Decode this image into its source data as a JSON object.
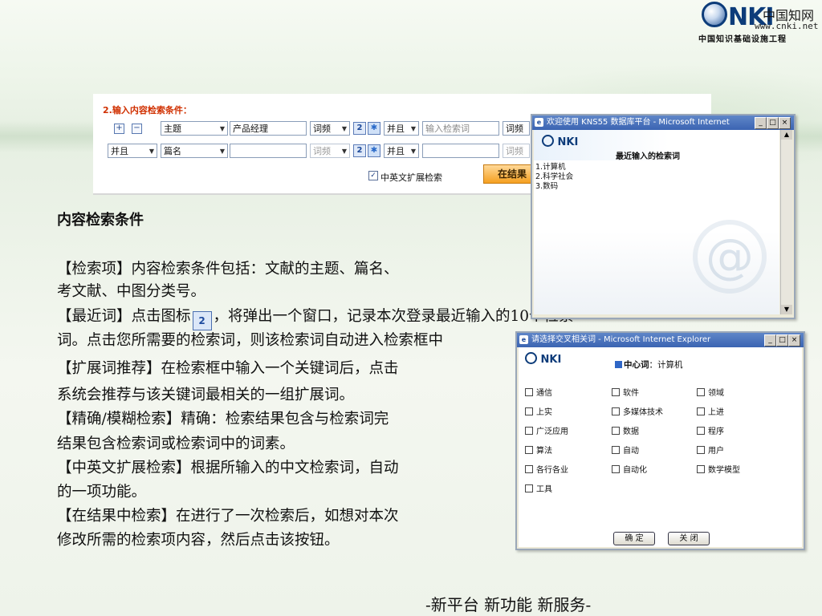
{
  "logo": {
    "cn": "中国知网",
    "url": "www.cnki.net",
    "sub": "中国知识基础设施工程",
    "mark": "NKI"
  },
  "search_panel": {
    "title": "2.输入内容检索条件：",
    "row1": {
      "field": "主题",
      "value": "产品经理",
      "freq": "词频",
      "logic": "并且",
      "placeholder": "输入检索词",
      "freq2": "词频"
    },
    "row2": {
      "logic_left": "并且",
      "field": "篇名",
      "value": "",
      "freq": "词频",
      "logic": "并且",
      "value2": "",
      "freq2": "词频"
    },
    "ext_label": "中英文扩展检索",
    "ext_checked": true,
    "search_in_results": "在结果"
  },
  "body": {
    "heading": "内容检索条件",
    "lines": [
      "【检索项】内容检索条件包括：文献的主题、篇名、",
      "考文献、中图分类号。",
      "【最近词】点击图标",
      "，将弹出一个窗口，记录本次登录最近输入的10个检索",
      "词。点击您所需要的检索词，则该检索词自动进入检索框中",
      "【扩展词推荐】在检索框中输入一个关键词后，点击",
      "系统会推荐与该关键词最相关的一组扩展词。",
      "【精确/模糊检索】精确：检索结果包含与检索词完",
      "结果包含检索词或检索词中的词素。",
      "【中英文扩展检索】根据所输入的中文检索词，自动",
      "的一项功能。",
      "【在结果中检索】在进行了一次检索后，如想对本次",
      "修改所需的检索项内容，然后点击该按钮。"
    ]
  },
  "footer": "-新平台 新功能 新服务-",
  "recent_window": {
    "title": "欢迎使用 KNS55 数据库平台 - Microsoft Internet",
    "heading": "最近输入的检索词",
    "items": [
      "1.计算机",
      "2.科学社会",
      "3.数码"
    ]
  },
  "expand_window": {
    "title": "请选择交叉相关词 - Microsoft Internet Explorer",
    "center_label": "中心词",
    "center_word": "计算机",
    "options": [
      "通信",
      "软件",
      "领域",
      "上实",
      "多媒体技术",
      "上进",
      "广泛应用",
      "数据",
      "程序",
      "算法",
      "自动",
      "用户",
      "各行各业",
      "自动化",
      "数学模型",
      "工具"
    ],
    "ok": "确 定",
    "close": "关 闭"
  }
}
